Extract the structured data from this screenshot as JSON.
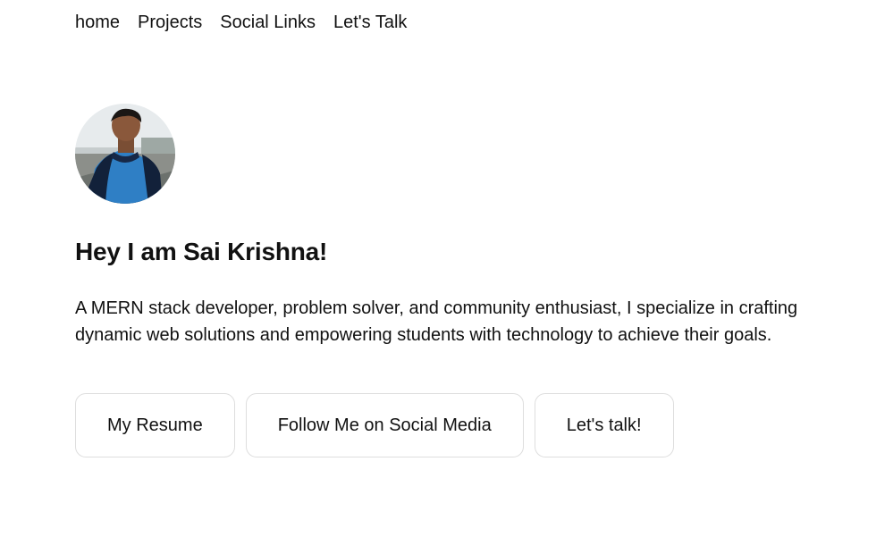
{
  "nav": {
    "items": [
      {
        "label": "home"
      },
      {
        "label": "Projects"
      },
      {
        "label": "Social Links"
      },
      {
        "label": "Let's Talk"
      }
    ]
  },
  "profile": {
    "avatar_icon": "profile-photo",
    "heading": "Hey I am Sai Krishna!",
    "intro": "A MERN stack developer, problem solver, and community enthusiast, I specialize in crafting dynamic web solutions and empowering students with technology to achieve their goals."
  },
  "actions": {
    "resume": "My Resume",
    "social": "Follow Me on Social Media",
    "talk": "Let's talk!"
  }
}
